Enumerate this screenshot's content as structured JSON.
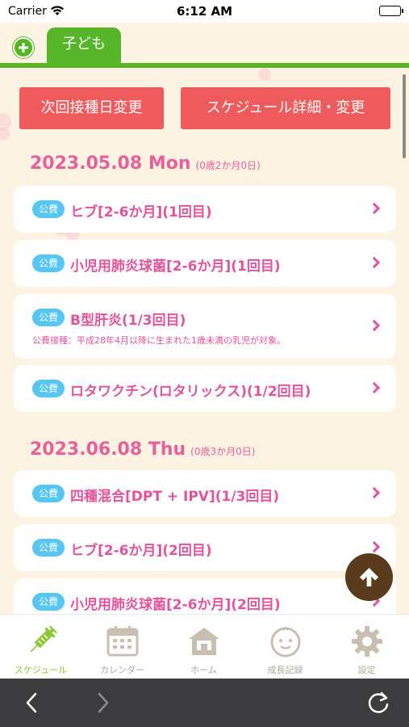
{
  "status_bar": {
    "carrier": "Carrier",
    "time": "6:12 AM"
  },
  "tabs": {
    "add_label": "",
    "child_tab": "子ども"
  },
  "actions": {
    "next_vaccination_change": "次回接種日変更",
    "schedule_detail_change": "スケジュール詳細・変更"
  },
  "schedule": [
    {
      "date": "2023.05.08 Mon",
      "age": "(0歳2か月0日)",
      "items": [
        {
          "badge": "公費",
          "name": "ヒブ[2-6か月](1回目)",
          "note": ""
        },
        {
          "badge": "公費",
          "name": "小児用肺炎球菌[2-6か月](1回目)",
          "note": ""
        },
        {
          "badge": "公費",
          "name": "B型肝炎(1/3回目)",
          "note": "公費接種：平成28年4月以降に生まれた1歳未満の乳児が対象。"
        },
        {
          "badge": "公費",
          "name": "ロタワクチン(ロタリックス)(1/2回目)",
          "note": ""
        }
      ]
    },
    {
      "date": "2023.06.08 Thu",
      "age": "(0歳3か月0日)",
      "items": [
        {
          "badge": "公費",
          "name": "四種混合[DPT + IPV](1/3回目)",
          "note": ""
        },
        {
          "badge": "公費",
          "name": "ヒブ[2-6か月](2回目)",
          "note": ""
        },
        {
          "badge": "公費",
          "name": "小児用肺炎球菌[2-6か月](2回目)",
          "note": ""
        }
      ]
    }
  ],
  "bottom_nav": [
    {
      "label": "スケジュール",
      "icon": "syringe-icon",
      "active": true
    },
    {
      "label": "カレンダー",
      "icon": "calendar-icon",
      "active": false
    },
    {
      "label": "ホーム",
      "icon": "home-icon",
      "active": false
    },
    {
      "label": "成長記録",
      "icon": "baby-face-icon",
      "active": false
    },
    {
      "label": "設定",
      "icon": "gear-icon",
      "active": false
    }
  ],
  "colors": {
    "accent_green": "#57b52a",
    "action_red": "#ef5b5c",
    "date_pink": "#e8609a",
    "badge_blue": "#56c6f2",
    "fab_brown": "#5a3b1c",
    "background": "#fdf3e3"
  }
}
